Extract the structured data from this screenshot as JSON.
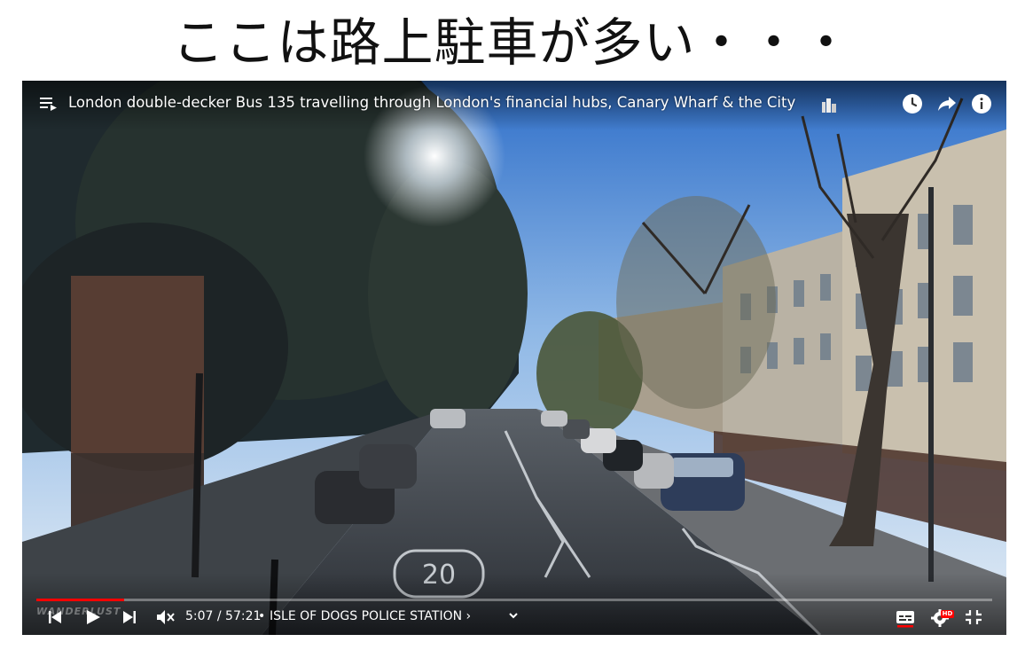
{
  "caption": "ここは路上駐車が多い・・・",
  "player": {
    "title": "London double-decker Bus 135 travelling through London's financial hubs, Canary Wharf & the City",
    "progress_fraction": 0.092,
    "time": "5:07 / 57:21",
    "separator": "•",
    "chapter": "ISLE OF DOGS POLICE STATION ›",
    "watermark": "WANDERLUST",
    "hd_badge": "HD",
    "road_marking": "20",
    "icons": {
      "playlist": "playlist-icon",
      "watch_later": "clock-icon",
      "share": "share-icon",
      "info": "info-icon",
      "previous": "skip-previous-icon",
      "play": "play-icon",
      "next": "skip-next-icon",
      "volume": "volume-muted-icon",
      "chapter_toggle": "chevron-down-icon",
      "subtitles": "subtitles-icon",
      "settings": "gear-icon",
      "exit_fullscreen": "exit-fullscreen-icon"
    },
    "colors": {
      "progress": "#ff0000",
      "hd": "#ff0000",
      "text": "#ffffff"
    }
  }
}
